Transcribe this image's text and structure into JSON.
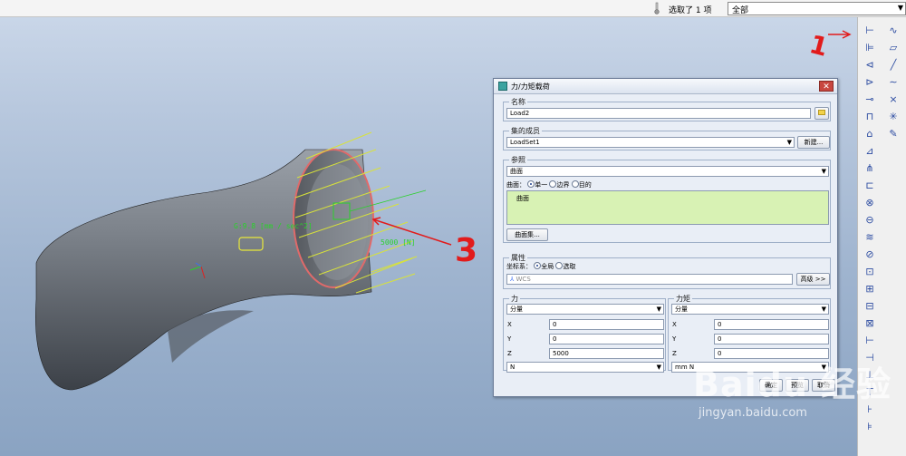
{
  "topbar": {
    "selection_text": "选取了 1 项",
    "filter_value": "全部"
  },
  "model": {
    "gravity_label": "G:9.8 [mm / sec^2]",
    "force_label": "5000 [N]"
  },
  "dialog": {
    "title": "力/力矩载荷",
    "name": {
      "label": "名称",
      "value": "Load2"
    },
    "set_member": {
      "label": "集的成员",
      "value": "LoadSet1",
      "new_button": "新建..."
    },
    "reference": {
      "label": "参照",
      "type_value": "曲面",
      "surface_label": "曲面：",
      "options": [
        "单一",
        "边界",
        "目的"
      ],
      "selected_option": "单一",
      "items": [
        "曲面"
      ],
      "surface_set_button": "曲面集..."
    },
    "properties": {
      "label": "属性",
      "csys_label": "坐标系：",
      "options": [
        "全局",
        "选取"
      ],
      "selected_option": "全局",
      "csys_value": "WCS",
      "advanced_button": "高级 >>"
    },
    "force": {
      "label": "力",
      "mode": "分量",
      "x": "0",
      "y": "0",
      "z": "5000",
      "unit": "N"
    },
    "moment": {
      "label": "力矩",
      "mode": "分量",
      "x": "0",
      "y": "0",
      "z": "0",
      "unit": "mm N"
    },
    "axis_labels": {
      "x": "X",
      "y": "Y",
      "z": "Z"
    },
    "buttons": {
      "ok": "确定",
      "preview": "预览",
      "cancel": "取消"
    }
  },
  "annotations": {
    "one": "1",
    "two": "2",
    "three": "3",
    "color": "#e21b1b"
  },
  "watermark": {
    "main": "Baidu 经验",
    "sub": "jingyan.baidu.com"
  },
  "colors": {
    "accent": "#2a4aa0",
    "viewport_top": "#c9d6e8",
    "viewport_bottom": "#8aa3c2",
    "list_bg": "#d8f2b4"
  }
}
